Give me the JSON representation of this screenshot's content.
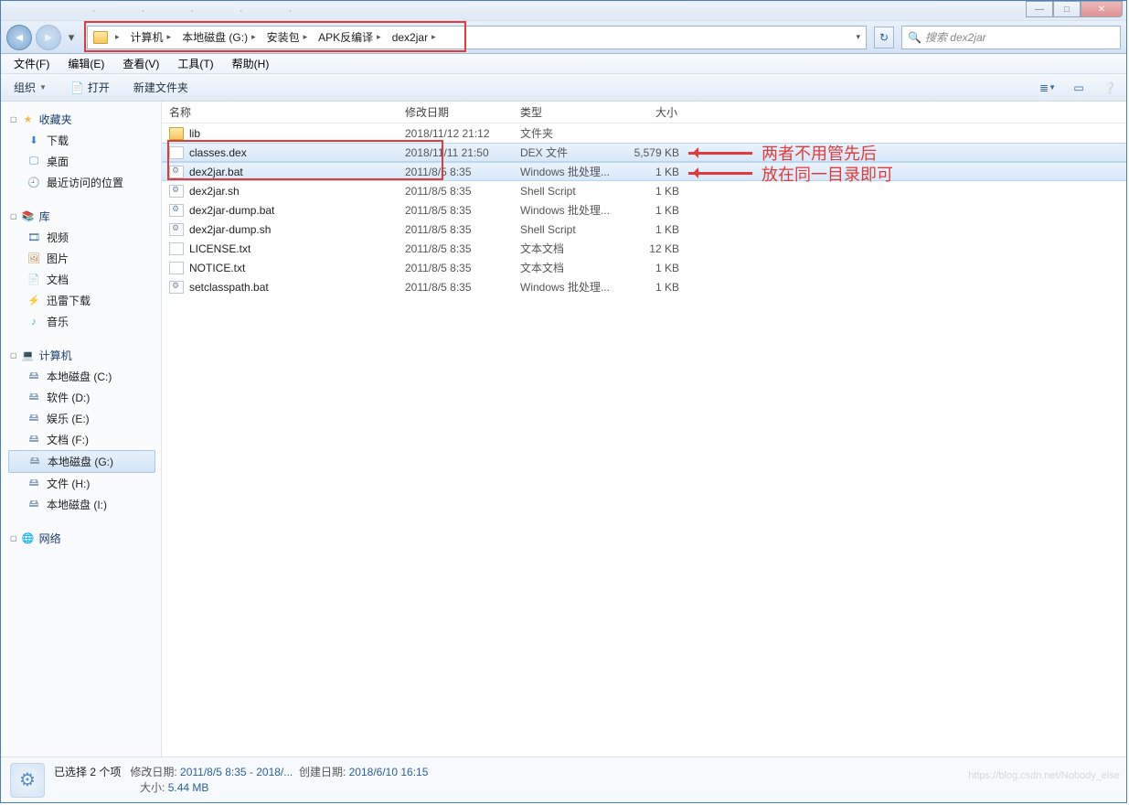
{
  "window_buttons": {
    "min": "—",
    "max": "□",
    "close": "✕"
  },
  "breadcrumb": [
    "计算机",
    "本地磁盘 (G:)",
    "安装包",
    "APK反编译",
    "dex2jar"
  ],
  "search_placeholder": "搜索 dex2jar",
  "menubar": [
    "文件(F)",
    "编辑(E)",
    "查看(V)",
    "工具(T)",
    "帮助(H)"
  ],
  "toolbar": {
    "org": "组织",
    "open": "打开",
    "new": "新建文件夹"
  },
  "columns": {
    "name": "名称",
    "date": "修改日期",
    "type": "类型",
    "size": "大小"
  },
  "sidebar": {
    "fav": {
      "title": "收藏夹",
      "items": [
        "下载",
        "桌面",
        "最近访问的位置"
      ]
    },
    "lib": {
      "title": "库",
      "items": [
        "视频",
        "图片",
        "文档",
        "迅雷下载",
        "音乐"
      ]
    },
    "pc": {
      "title": "计算机",
      "items": [
        "本地磁盘 (C:)",
        "软件 (D:)",
        "娱乐 (E:)",
        "文档 (F:)",
        "本地磁盘 (G:)",
        "文件 (H:)",
        "本地磁盘 (I:)"
      ]
    },
    "net": {
      "title": "网络"
    }
  },
  "files": [
    {
      "name": "lib",
      "date": "2018/11/12 21:12",
      "type": "文件夹",
      "size": "",
      "icon": "folder",
      "sel": false
    },
    {
      "name": "classes.dex",
      "date": "2018/11/11 21:50",
      "type": "DEX 文件",
      "size": "5,579 KB",
      "icon": "file",
      "sel": true
    },
    {
      "name": "dex2jar.bat",
      "date": "2011/8/5 8:35",
      "type": "Windows 批处理...",
      "size": "1 KB",
      "icon": "bat",
      "sel": true
    },
    {
      "name": "dex2jar.sh",
      "date": "2011/8/5 8:35",
      "type": "Shell Script",
      "size": "1 KB",
      "icon": "bat",
      "sel": false
    },
    {
      "name": "dex2jar-dump.bat",
      "date": "2011/8/5 8:35",
      "type": "Windows 批处理...",
      "size": "1 KB",
      "icon": "bat",
      "sel": false
    },
    {
      "name": "dex2jar-dump.sh",
      "date": "2011/8/5 8:35",
      "type": "Shell Script",
      "size": "1 KB",
      "icon": "bat",
      "sel": false
    },
    {
      "name": "LICENSE.txt",
      "date": "2011/8/5 8:35",
      "type": "文本文档",
      "size": "12 KB",
      "icon": "file",
      "sel": false
    },
    {
      "name": "NOTICE.txt",
      "date": "2011/8/5 8:35",
      "type": "文本文档",
      "size": "1 KB",
      "icon": "file",
      "sel": false
    },
    {
      "name": "setclasspath.bat",
      "date": "2011/8/5 8:35",
      "type": "Windows 批处理...",
      "size": "1 KB",
      "icon": "bat",
      "sel": false
    }
  ],
  "annotation": {
    "line1": "两者不用管先后",
    "line2": "放在同一目录即可"
  },
  "status": {
    "title": "已选择 2 个项",
    "date_label": "修改日期:",
    "date_value": "2011/8/5 8:35 - 2018/...",
    "create_label": "创建日期:",
    "create_value": "2018/6/10 16:15",
    "size_label": "大小:",
    "size_value": "5.44 MB"
  },
  "watermark": "https://blog.csdn.net/Nobody_else"
}
